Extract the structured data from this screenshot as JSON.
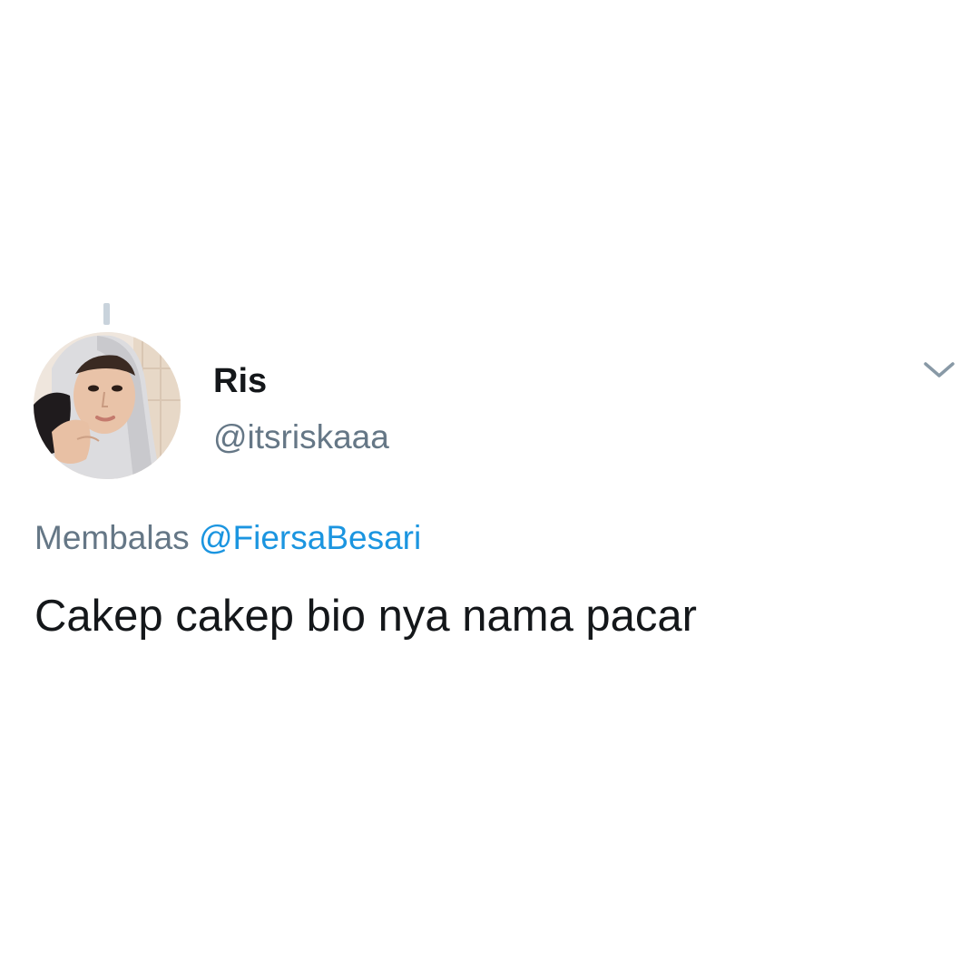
{
  "tweet": {
    "author": {
      "display_name": "Ris",
      "handle": "@itsriskaaa",
      "avatar_icon": "profile-photo"
    },
    "reply": {
      "prefix": "Membalas",
      "mention": "@FiersaBesari"
    },
    "text": "Cakep cakep bio nya nama pacar",
    "menu_icon": "chevron-down-icon"
  },
  "colors": {
    "background": "#ffffff",
    "primary_text": "#14171a",
    "secondary_text": "#657786",
    "link": "#1b95e0",
    "thread_line": "#c9d3dc"
  }
}
